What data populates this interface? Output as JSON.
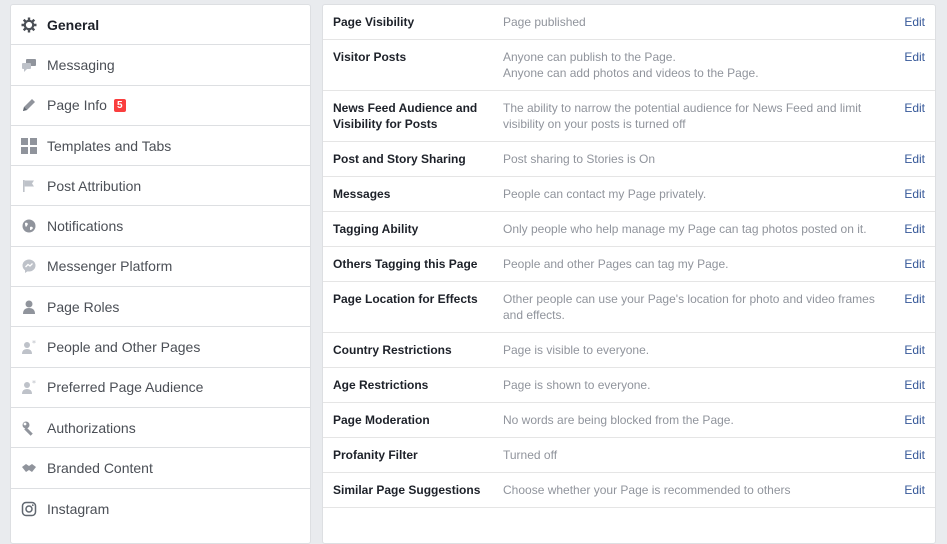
{
  "sidebar": {
    "items": [
      {
        "label": "General",
        "icon": "gear-icon"
      },
      {
        "label": "Messaging",
        "icon": "chat-bubbles-icon"
      },
      {
        "label": "Page Info",
        "icon": "pencil-icon",
        "badge": "5"
      },
      {
        "label": "Templates and Tabs",
        "icon": "grid-icon"
      },
      {
        "label": "Post Attribution",
        "icon": "flag-icon"
      },
      {
        "label": "Notifications",
        "icon": "globe-icon"
      },
      {
        "label": "Messenger Platform",
        "icon": "messenger-icon"
      },
      {
        "label": "Page Roles",
        "icon": "person-icon"
      },
      {
        "label": "People and Other Pages",
        "icon": "person-star-icon"
      },
      {
        "label": "Preferred Page Audience",
        "icon": "person-star-icon"
      },
      {
        "label": "Authorizations",
        "icon": "wrench-icon"
      },
      {
        "label": "Branded Content",
        "icon": "handshake-icon"
      },
      {
        "label": "Instagram",
        "icon": "instagram-icon"
      }
    ]
  },
  "settings": {
    "edit_label": "Edit",
    "rows": [
      {
        "name": "Page Visibility",
        "desc": [
          "Page published"
        ]
      },
      {
        "name": "Visitor Posts",
        "desc": [
          "Anyone can publish to the Page.",
          "Anyone can add photos and videos to the Page."
        ]
      },
      {
        "name": "News Feed Audience and Visibility for Posts",
        "desc": [
          "The ability to narrow the potential audience for News Feed and limit",
          "visibility on your posts is turned off"
        ]
      },
      {
        "name": "Post and Story Sharing",
        "desc": [
          "Post sharing to Stories is On"
        ]
      },
      {
        "name": "Messages",
        "desc": [
          "People can contact my Page privately."
        ]
      },
      {
        "name": "Tagging Ability",
        "desc": [
          "Only people who help manage my Page can tag photos posted on it."
        ]
      },
      {
        "name": "Others Tagging this Page",
        "desc": [
          "People and other Pages can tag my Page."
        ]
      },
      {
        "name": "Page Location for Effects",
        "desc": [
          "Other people can use your Page's location for photo and video frames",
          "and effects."
        ]
      },
      {
        "name": "Country Restrictions",
        "desc": [
          "Page is visible to everyone."
        ]
      },
      {
        "name": "Age Restrictions",
        "desc": [
          "Page is shown to everyone."
        ]
      },
      {
        "name": "Page Moderation",
        "desc": [
          "No words are being blocked from the Page."
        ]
      },
      {
        "name": "Profanity Filter",
        "desc": [
          "Turned off"
        ]
      },
      {
        "name": "Similar Page Suggestions",
        "desc": [
          "Choose whether your Page is recommended to others"
        ]
      }
    ]
  }
}
